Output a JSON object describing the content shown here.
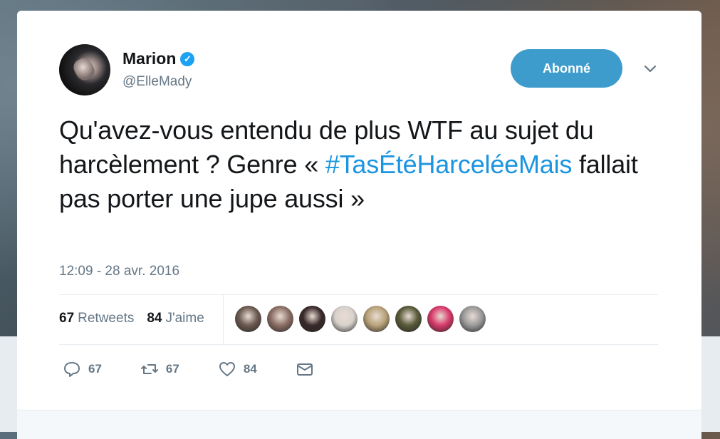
{
  "user": {
    "display_name": "Marion",
    "handle": "@ElleMady",
    "verified": true
  },
  "follow_button": {
    "label": "Abonné",
    "color": "#3d9ccb"
  },
  "tweet": {
    "text_part1": "Qu'avez-vous entendu de plus WTF au sujet du harcèlement ? Genre « ",
    "hashtag": "#TasÉtéHarceléeMais",
    "text_part2": " fallait pas porter une jupe aussi »",
    "timestamp": "12:09 - 28 avr. 2016"
  },
  "stats": {
    "retweets_count": "67",
    "retweets_label": "Retweets",
    "likes_count": "84",
    "likes_label": "J'aime"
  },
  "likers": [
    {
      "icon": "liker-avatar",
      "color": "#6b5a50"
    },
    {
      "icon": "liker-avatar",
      "color": "#8c6f66"
    },
    {
      "icon": "liker-avatar",
      "color": "#3a2a2a"
    },
    {
      "icon": "liker-avatar",
      "color": "#d8d2cc"
    },
    {
      "icon": "liker-avatar",
      "color": "#b9a37a"
    },
    {
      "icon": "liker-avatar",
      "color": "#5a5a3a"
    },
    {
      "icon": "liker-avatar",
      "color": "#d83a6a"
    },
    {
      "icon": "liker-avatar",
      "color": "#9a9a9a"
    }
  ],
  "actions": {
    "reply_count": "67",
    "retweet_count": "67",
    "like_count": "84"
  },
  "colors": {
    "link": "#1b95e0",
    "muted": "#657786",
    "text": "#14171a"
  }
}
